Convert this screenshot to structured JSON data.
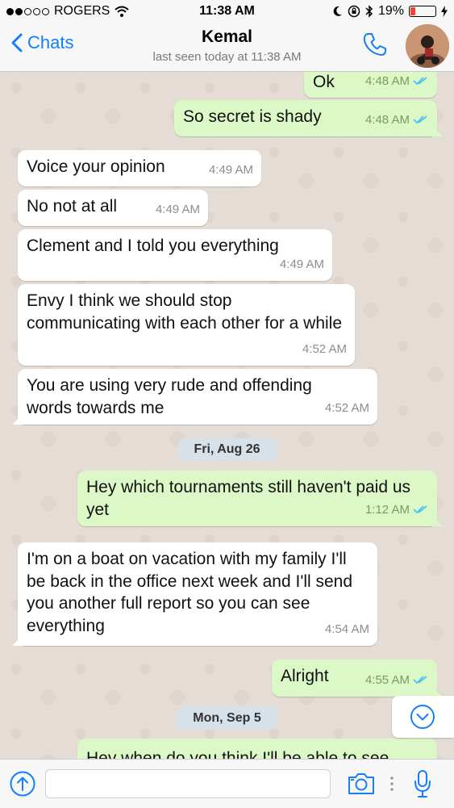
{
  "status_bar": {
    "carrier": "ROGERS",
    "signal_bars_filled": 2,
    "signal_bars_total": 5,
    "time": "11:38 AM",
    "battery": "19%",
    "battery_level": 0.19,
    "icons": [
      "wifi-icon",
      "moon-icon",
      "rotation-lock-icon",
      "bluetooth-icon",
      "battery-icon",
      "charging-icon"
    ]
  },
  "header": {
    "back_label": "Chats",
    "contact_name": "Kemal",
    "last_seen": "last seen today at 11:38 AM",
    "icons": [
      "chevron-left-icon",
      "phone-icon",
      "avatar"
    ]
  },
  "messages": [
    {
      "dir": "out",
      "text": "Ok",
      "time": "4:48 AM",
      "read": true
    },
    {
      "dir": "out",
      "text": "So secret is shady",
      "time": "4:48 AM",
      "read": true
    },
    {
      "dir": "in",
      "text": "Voice your opinion",
      "time": "4:49 AM"
    },
    {
      "dir": "in",
      "text": "No not at all",
      "time": "4:49 AM"
    },
    {
      "dir": "in",
      "text": "Clement and I told you everything",
      "time": "4:49 AM"
    },
    {
      "dir": "in",
      "text": "Envy I think we should stop communicating with each other for a while",
      "time": "4:52 AM"
    },
    {
      "dir": "in",
      "text": "You are using very rude and offending words towards me",
      "time": "4:52 AM"
    },
    {
      "type": "date",
      "label": "Fri, Aug 26"
    },
    {
      "dir": "out",
      "text": "Hey which tournaments still haven't paid us yet",
      "time": "1:12 AM",
      "read": true
    },
    {
      "dir": "in",
      "text": "I'm on a boat on vacation with my family I'll be back in the office next week and I'll send you another full report so you can see everything",
      "time": "4:54 AM"
    },
    {
      "dir": "out",
      "text": "Alright",
      "time": "4:55 AM",
      "read": true
    },
    {
      "type": "date",
      "label": "Mon, Sep 5"
    },
    {
      "dir": "out",
      "text": "Hey when do you think I'll be able to see",
      "partial": true
    }
  ],
  "input": {
    "placeholder": "",
    "value": ""
  },
  "colors": {
    "accent": "#147efb",
    "outgoing_bubble": "#dcf8c6",
    "incoming_bubble": "#ffffff",
    "read_ticks": "#4fc3f7",
    "chat_bg": "#e5ddd5",
    "battery_low": "#ff3b30"
  }
}
